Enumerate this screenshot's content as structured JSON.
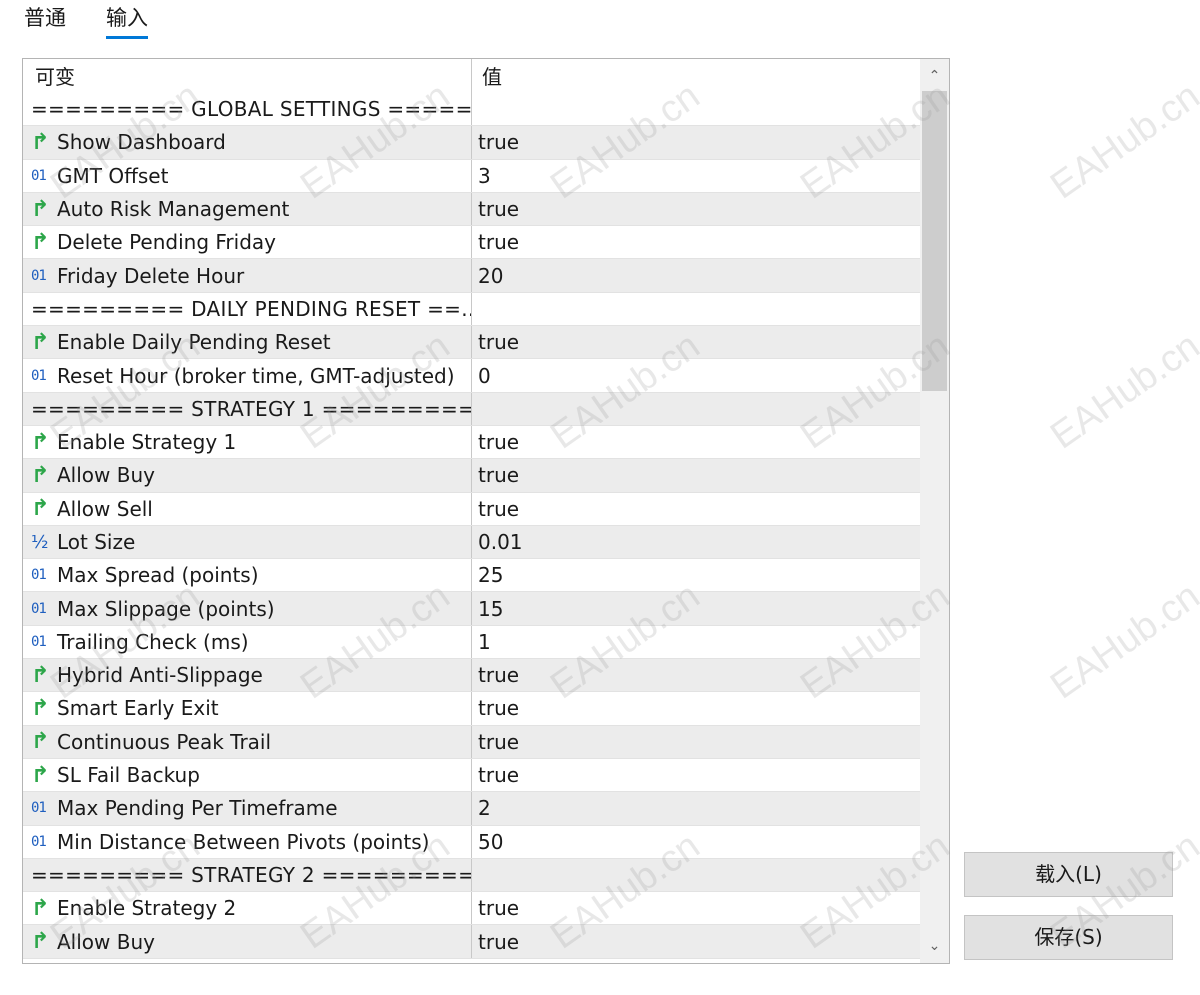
{
  "tabs": [
    {
      "label": "普通"
    },
    {
      "label": "输入"
    }
  ],
  "grid": {
    "header": {
      "variable": "可变",
      "value": "值"
    },
    "rows": [
      {
        "type": "sep",
        "name": "========= GLOBAL SETTINGS =====...",
        "value": ""
      },
      {
        "type": "bool",
        "name": "Show Dashboard",
        "value": "true"
      },
      {
        "type": "int",
        "name": "GMT Offset",
        "value": "3"
      },
      {
        "type": "bool",
        "name": "Auto Risk Management",
        "value": "true"
      },
      {
        "type": "bool",
        "name": "Delete Pending Friday",
        "value": "true"
      },
      {
        "type": "int",
        "name": "Friday Delete Hour",
        "value": "20"
      },
      {
        "type": "sep",
        "name": "========= DAILY PENDING RESET ==...",
        "value": ""
      },
      {
        "type": "bool",
        "name": "Enable Daily Pending Reset",
        "value": "true"
      },
      {
        "type": "int",
        "name": "Reset Hour (broker time, GMT-adjusted)",
        "value": "0"
      },
      {
        "type": "sep",
        "name": "========= STRATEGY 1  =========",
        "value": ""
      },
      {
        "type": "bool",
        "name": "Enable Strategy 1",
        "value": "true"
      },
      {
        "type": "bool",
        "name": "Allow Buy",
        "value": "true"
      },
      {
        "type": "bool",
        "name": "Allow Sell",
        "value": "true"
      },
      {
        "type": "dbl",
        "name": "Lot Size",
        "value": "0.01"
      },
      {
        "type": "int",
        "name": "Max Spread (points)",
        "value": "25"
      },
      {
        "type": "int",
        "name": "Max Slippage (points)",
        "value": "15"
      },
      {
        "type": "int",
        "name": "Trailing Check (ms)",
        "value": "1"
      },
      {
        "type": "bool",
        "name": "Hybrid Anti-Slippage",
        "value": "true"
      },
      {
        "type": "bool",
        "name": "Smart Early Exit",
        "value": "true"
      },
      {
        "type": "bool",
        "name": "Continuous Peak Trail",
        "value": "true"
      },
      {
        "type": "bool",
        "name": "SL Fail Backup",
        "value": "true"
      },
      {
        "type": "int",
        "name": "Max Pending Per Timeframe",
        "value": "2"
      },
      {
        "type": "int",
        "name": "Min Distance Between Pivots (points)",
        "value": "50"
      },
      {
        "type": "sep",
        "name": "========= STRATEGY 2  =========",
        "value": ""
      },
      {
        "type": "bool",
        "name": "Enable Strategy 2",
        "value": "true"
      },
      {
        "type": "bool",
        "name": "Allow Buy",
        "value": "true"
      }
    ]
  },
  "icons": {
    "bool": "↱",
    "int": "01",
    "dbl": "½"
  },
  "buttons": {
    "load": "载入(L)",
    "save": "保存(S)"
  },
  "scrollbar": {
    "up_icon": "⌃",
    "down_icon": "⌄"
  },
  "watermark": "EAHub.cn"
}
